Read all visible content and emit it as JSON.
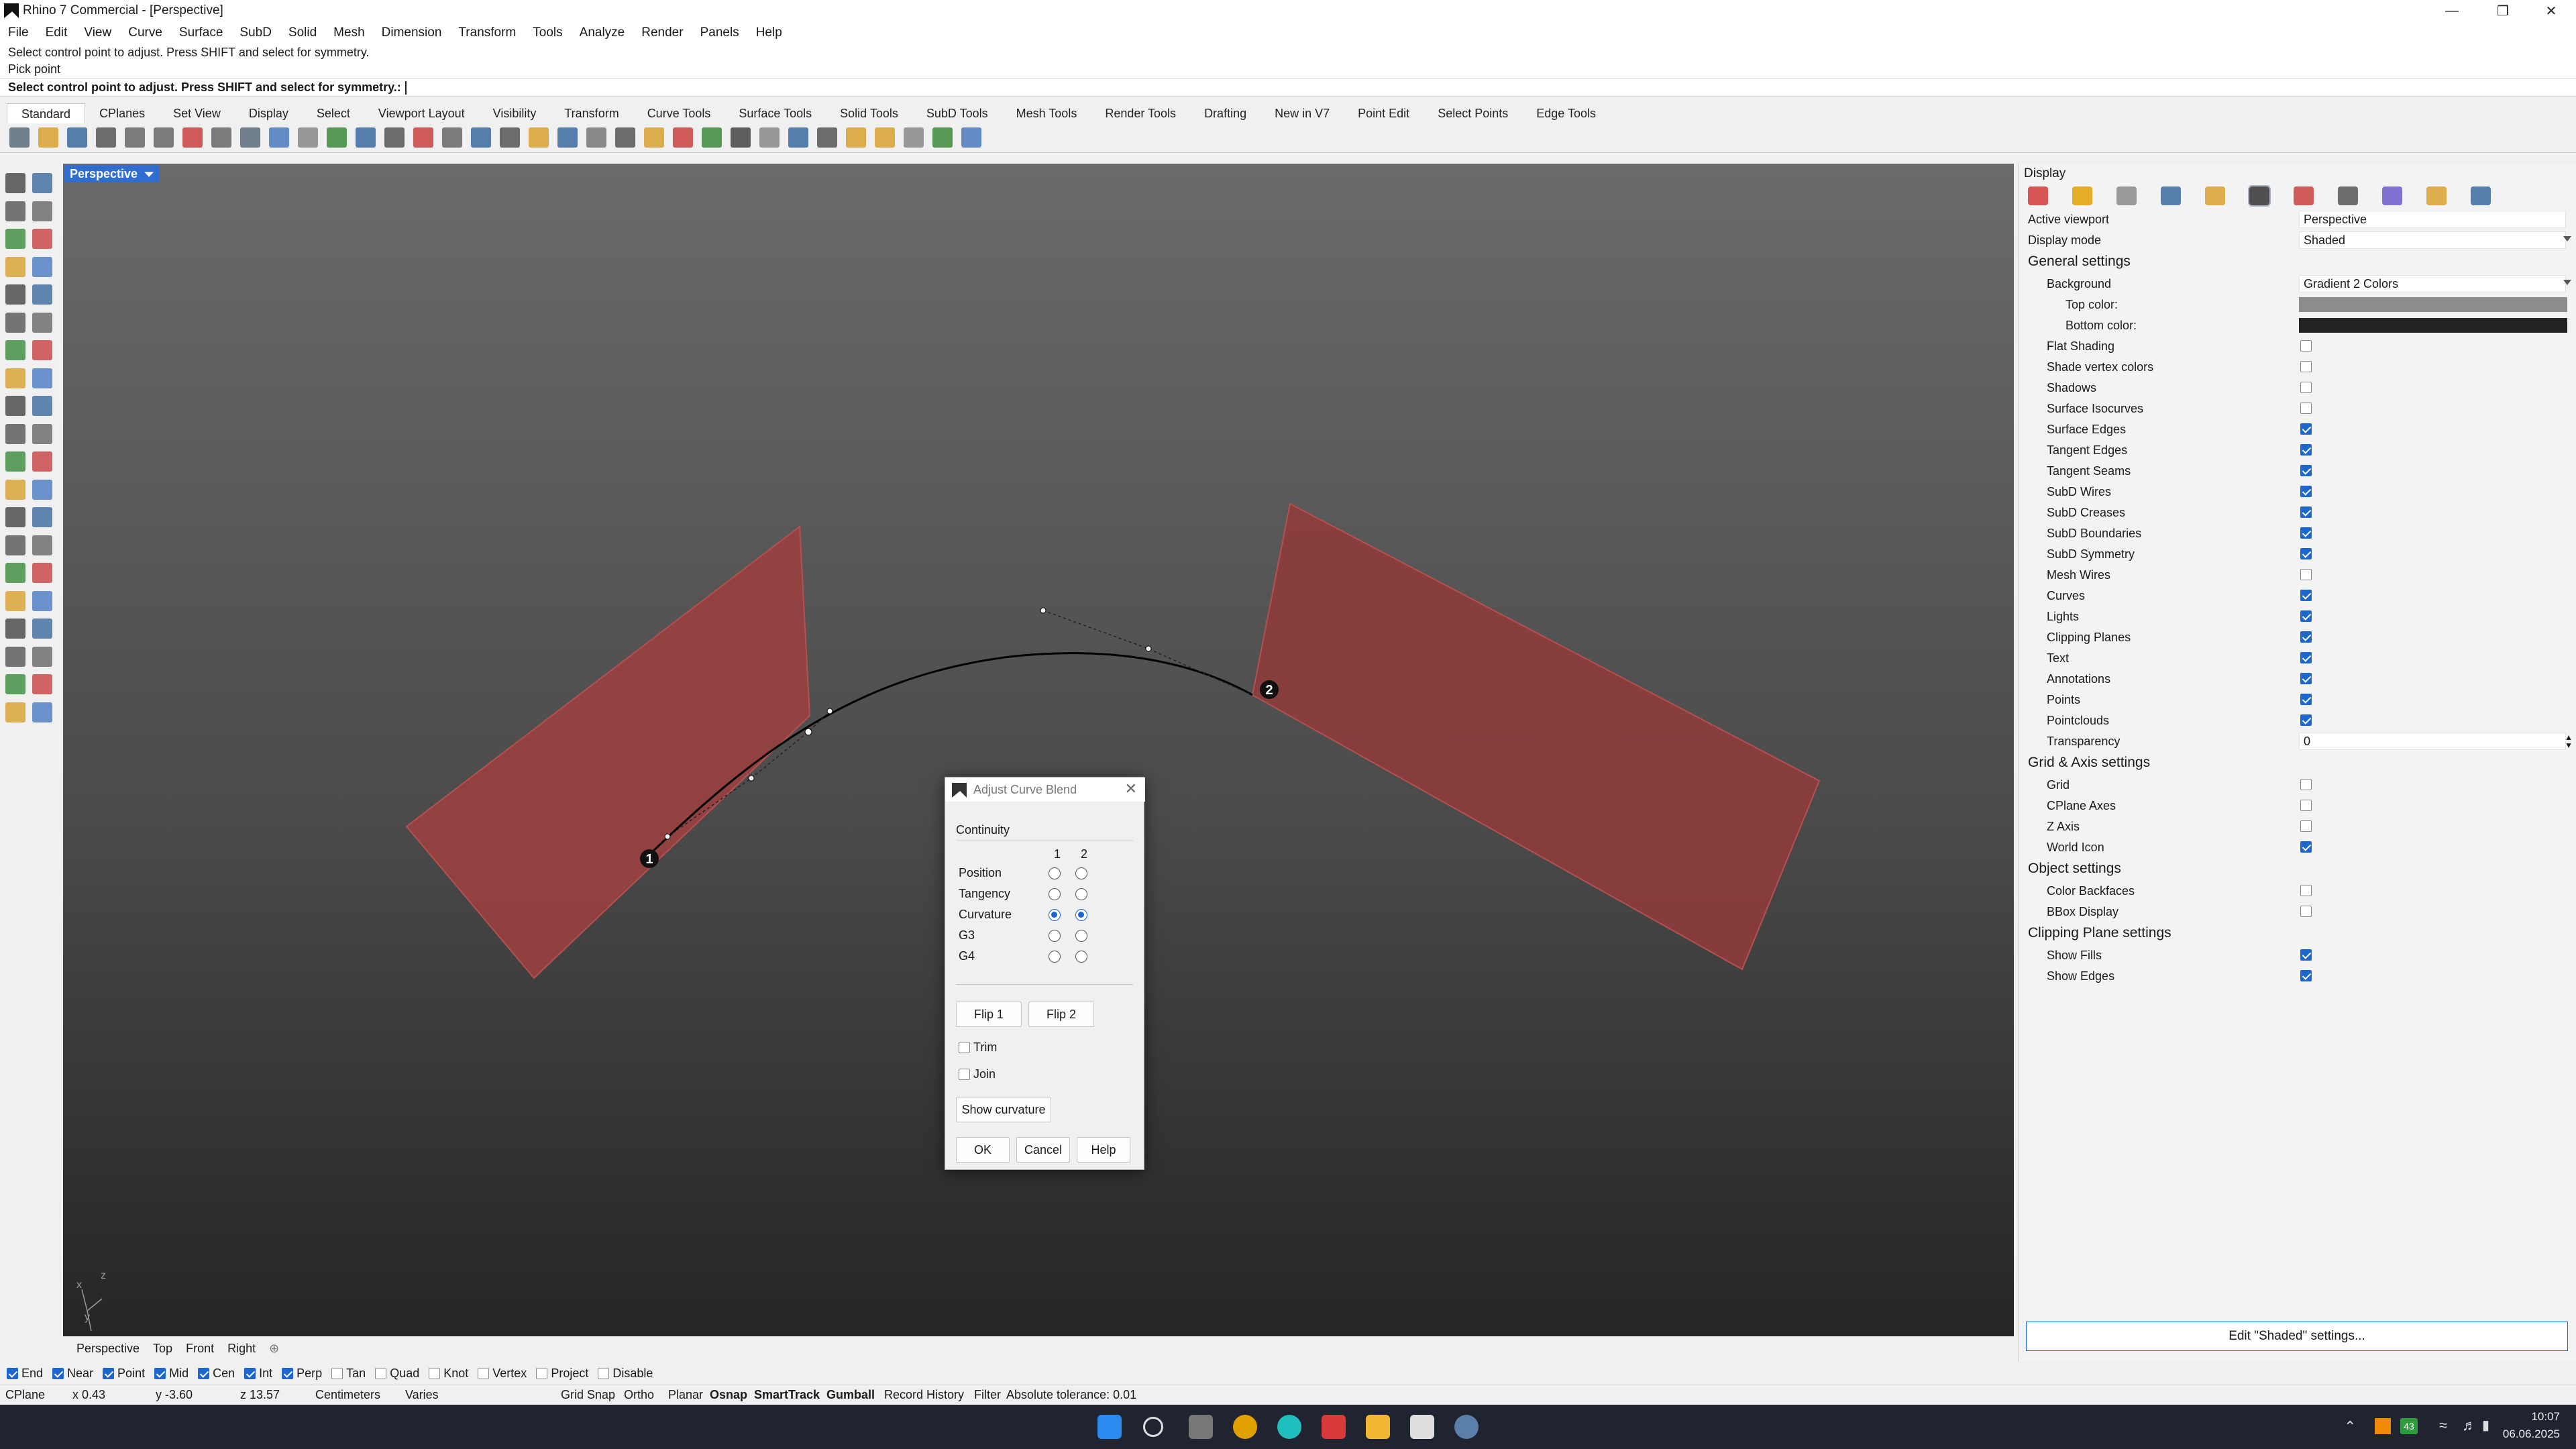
{
  "window": {
    "title": "Rhino 7 Commercial - [Perspective]"
  },
  "menu": [
    "File",
    "Edit",
    "View",
    "Curve",
    "Surface",
    "SubD",
    "Solid",
    "Mesh",
    "Dimension",
    "Transform",
    "Tools",
    "Analyze",
    "Render",
    "Panels",
    "Help"
  ],
  "command": {
    "history": [
      "Select control point to adjust. Press SHIFT and select for symmetry.",
      "Pick point"
    ],
    "prompt": "Select control point to adjust. Press SHIFT and select for symmetry.:"
  },
  "toolbar_tabs": [
    "Standard",
    "CPlanes",
    "Set View",
    "Display",
    "Select",
    "Viewport Layout",
    "Visibility",
    "Transform",
    "Curve Tools",
    "Surface Tools",
    "Solid Tools",
    "SubD Tools",
    "Mesh Tools",
    "Render Tools",
    "Drafting",
    "New in V7",
    "Point Edit",
    "Select Points",
    "Edge Tools"
  ],
  "viewport": {
    "name": "Perspective",
    "marker1": "1",
    "marker2": "2",
    "axis_x": "x",
    "axis_z": "z",
    "axis_y": "y"
  },
  "viewport_tabs": [
    "Perspective",
    "Top",
    "Front",
    "Right"
  ],
  "dialog": {
    "title": "Adjust Curve Blend",
    "continuity": "Continuity",
    "col1": "1",
    "col2": "2",
    "options": [
      {
        "label": "Position",
        "a": false,
        "b": false
      },
      {
        "label": "Tangency",
        "a": false,
        "b": false
      },
      {
        "label": "Curvature",
        "a": true,
        "b": true
      },
      {
        "label": "G3",
        "a": false,
        "b": false
      },
      {
        "label": "G4",
        "a": false,
        "b": false
      }
    ],
    "flip1": "Flip 1",
    "flip2": "Flip 2",
    "trim": "Trim",
    "join": "Join",
    "show_curvature": "Show curvature",
    "ok": "OK",
    "cancel": "Cancel",
    "help": "Help"
  },
  "panel": {
    "title": "Display",
    "active_viewport_label": "Active viewport",
    "active_viewport": "Perspective",
    "display_mode_label": "Display mode",
    "display_mode": "Shaded",
    "general": "General settings",
    "background_label": "Background",
    "background": "Gradient 2 Colors",
    "top_color_label": "Top color:",
    "top_color": "#8c8c8c",
    "bottom_color_label": "Bottom color:",
    "bottom_color": "#232323",
    "general_items": [
      {
        "label": "Flat Shading",
        "on": false
      },
      {
        "label": "Shade vertex colors",
        "on": false
      },
      {
        "label": "Shadows",
        "on": false
      },
      {
        "label": "Surface Isocurves",
        "on": false
      },
      {
        "label": "Surface Edges",
        "on": true
      },
      {
        "label": "Tangent Edges",
        "on": true
      },
      {
        "label": "Tangent Seams",
        "on": true
      },
      {
        "label": "SubD Wires",
        "on": true
      },
      {
        "label": "SubD Creases",
        "on": true
      },
      {
        "label": "SubD Boundaries",
        "on": true
      },
      {
        "label": "SubD Symmetry",
        "on": true
      },
      {
        "label": "Mesh Wires",
        "on": false
      },
      {
        "label": "Curves",
        "on": true
      },
      {
        "label": "Lights",
        "on": true
      },
      {
        "label": "Clipping Planes",
        "on": true
      },
      {
        "label": "Text",
        "on": true
      },
      {
        "label": "Annotations",
        "on": true
      },
      {
        "label": "Points",
        "on": true
      },
      {
        "label": "Pointclouds",
        "on": true
      }
    ],
    "transparency_label": "Transparency",
    "transparency": "0",
    "grid_axis": "Grid & Axis settings",
    "grid_items": [
      {
        "label": "Grid",
        "on": false
      },
      {
        "label": "CPlane Axes",
        "on": false
      },
      {
        "label": "Z Axis",
        "on": false
      },
      {
        "label": "World Icon",
        "on": true
      }
    ],
    "object": "Object settings",
    "object_items": [
      {
        "label": "Color Backfaces",
        "on": false
      },
      {
        "label": "BBox Display",
        "on": false
      }
    ],
    "clipping": "Clipping Plane settings",
    "clipping_items": [
      {
        "label": "Show Fills",
        "on": true
      },
      {
        "label": "Show Edges",
        "on": true
      }
    ],
    "edit_button": "Edit \"Shaded\" settings..."
  },
  "osnaps": [
    {
      "label": "End",
      "on": true
    },
    {
      "label": "Near",
      "on": true
    },
    {
      "label": "Point",
      "on": true
    },
    {
      "label": "Mid",
      "on": true
    },
    {
      "label": "Cen",
      "on": true
    },
    {
      "label": "Int",
      "on": true
    },
    {
      "label": "Perp",
      "on": true
    },
    {
      "label": "Tan",
      "on": false
    },
    {
      "label": "Quad",
      "on": false
    },
    {
      "label": "Knot",
      "on": false
    },
    {
      "label": "Vertex",
      "on": false
    },
    {
      "label": "Project",
      "on": false
    },
    {
      "label": "Disable",
      "on": false
    }
  ],
  "status": {
    "cplane": "CPlane",
    "x": "x 0.43",
    "y": "y -3.60",
    "z": "z 13.57",
    "units": "Centimeters",
    "layer": "Varies",
    "grid_snap": "Grid Snap",
    "ortho": "Ortho",
    "planar": "Planar",
    "osnap": "Osnap",
    "smarttrack": "SmartTrack",
    "gumball": "Gumball",
    "record_history": "Record History",
    "filter": "Filter",
    "tolerance": "Absolute tolerance: 0.01"
  },
  "taskbar": {
    "time": "10:07",
    "date": "06.06.2025",
    "badge": "43"
  },
  "colors": {
    "accent": "#1c66d0",
    "surface": "#9a4040",
    "curve": "#000000"
  }
}
